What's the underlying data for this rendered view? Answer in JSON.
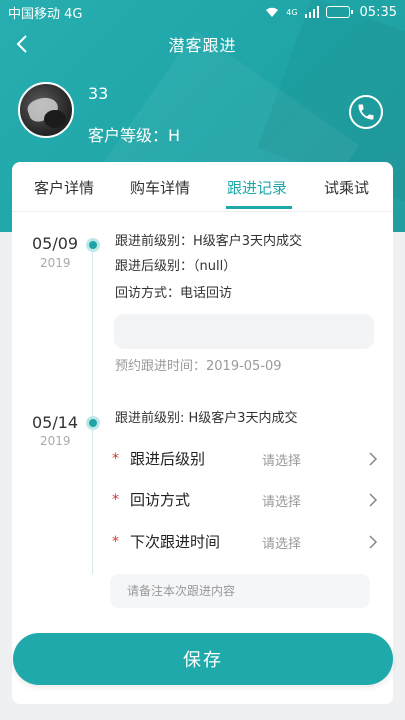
{
  "status_bar": {
    "carrier": "中国移动 4G",
    "network": "4G",
    "time": "05:35"
  },
  "nav": {
    "title": "潜客跟进"
  },
  "customer": {
    "name": "33",
    "level": "客户等级：H"
  },
  "tabs": [
    {
      "label": "客户详情",
      "active": false
    },
    {
      "label": "购车详情",
      "active": false
    },
    {
      "label": "跟进记录",
      "active": true
    },
    {
      "label": "试乘试",
      "active": false
    }
  ],
  "records": [
    {
      "date": "05/09",
      "year": "2019",
      "before_level": "跟进前级别：H级客户3天内成交",
      "after_level": "跟进后级别：（null）",
      "visit_method": "回访方式：电话回访",
      "note": "",
      "appointment": "预约跟进时间：2019-05-09"
    },
    {
      "date": "05/14",
      "year": "2019",
      "before_level": "跟进前级别: H级客户3天内成交"
    }
  ],
  "form": {
    "fields": [
      {
        "label": "跟进后级别",
        "value": "请选择",
        "required": true
      },
      {
        "label": "回访方式",
        "value": "请选择",
        "required": true
      },
      {
        "label": "下次跟进时间",
        "value": "请选择",
        "required": true
      }
    ],
    "remark_placeholder": "请备注本次跟进内容"
  },
  "save_label": "保存",
  "colors": {
    "primary": "#1fa5a7",
    "required": "#e03131",
    "background": "#eef0f2"
  },
  "icons": {
    "back": "chevron-left-icon",
    "phone": "phone-icon",
    "chevron": "chevron-right-icon"
  }
}
